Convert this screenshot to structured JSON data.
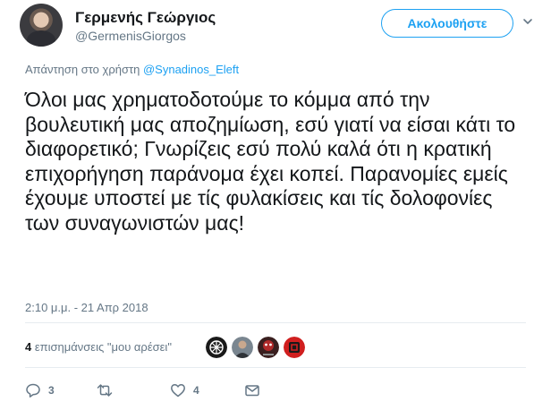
{
  "author": {
    "name": "Γερμενής Γεώργιος",
    "handle": "@GermenisGiorgos",
    "follow_label": "Ακολουθήστε"
  },
  "reply": {
    "prefix": "Απάντηση στο χρήστη",
    "mention": "@Synadinos_Eleft"
  },
  "tweet": {
    "text": "Όλοι μας χρηματοδοτούμε το κόμμα από την βουλευτική μας αποζημίωση, εσύ γιατί να είσαι κάτι το διαφορετικό; Γνωρίζεις εσύ πολύ καλά ότι η κρατική επιχορήγηση παράνομα έχει κοπεί. Παρανομίες εμείς έχουμε υποστεί με τίς φυλακίσεις και τίς δολοφονίες των συναγωνιστών μας!",
    "timestamp": "2:10 μ.μ. - 21 Απρ 2018"
  },
  "likes": {
    "count": "4",
    "label": "επισημάνσεις \"μου αρέσει\""
  },
  "actions": {
    "reply_count": "3",
    "retweet_count": "",
    "like_count": "4"
  },
  "colors": {
    "accent": "#1da1f2",
    "muted": "#657786",
    "text": "#14171a",
    "divider": "#e6ecf0"
  },
  "icons": {
    "chevron": "chevron-down-icon",
    "reply": "reply-icon",
    "retweet": "retweet-icon",
    "like": "heart-icon",
    "dm": "envelope-icon"
  }
}
